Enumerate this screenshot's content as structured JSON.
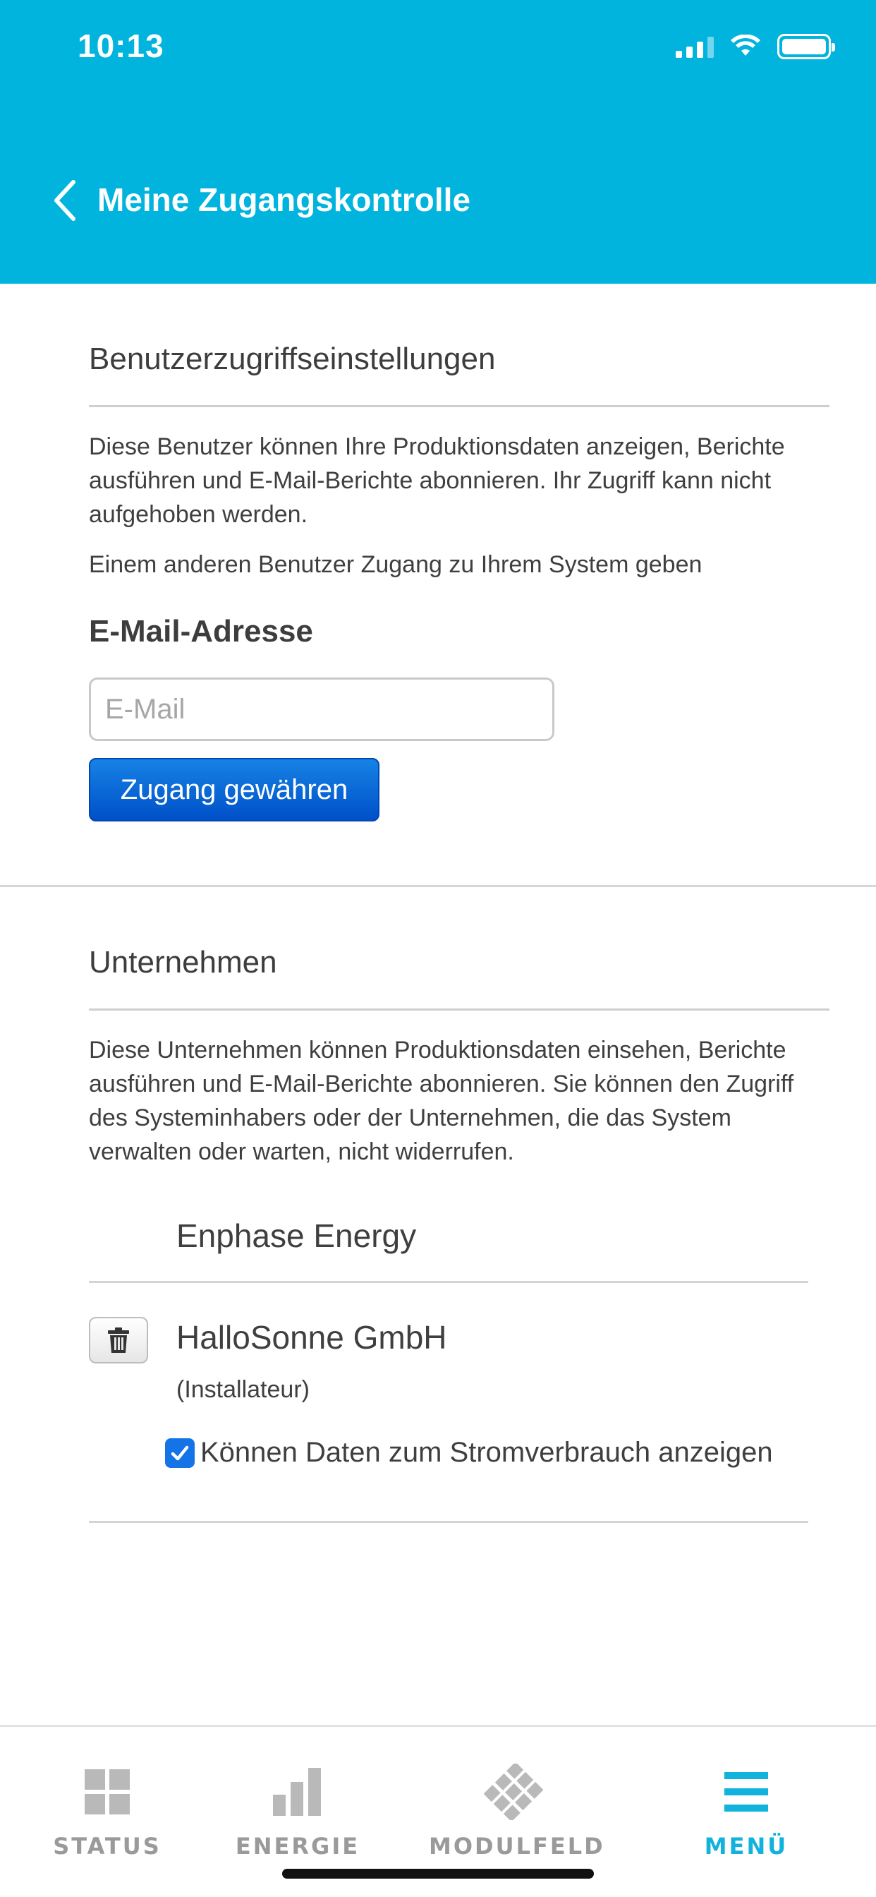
{
  "status_bar": {
    "time": "10:13"
  },
  "header": {
    "title": "Meine Zugangskontrolle"
  },
  "user_access": {
    "title": "Benutzerzugriffseinstellungen",
    "description": "Diese Benutzer können Ihre Produktionsdaten anzeigen, Berichte ausführen und E-Mail-Berichte abonnieren. Ihr Zugriff kann nicht aufgehoben werden.",
    "grant_text": "Einem anderen Benutzer Zugang zu Ihrem System geben",
    "email_label": "E-Mail-Adresse",
    "email_placeholder": "E-Mail",
    "email_value": "",
    "grant_button": "Zugang gewähren"
  },
  "companies": {
    "title": "Unternehmen",
    "description": "Diese Unternehmen können Produktionsdaten einsehen, Berichte ausführen und E-Mail-Berichte abonnieren. Sie können den Zugriff des Systeminhabers oder der Unternehmen, die das System verwalten oder warten, nicht widerrufen.",
    "items": [
      {
        "name": "Enphase Energy"
      },
      {
        "name": "HalloSonne GmbH",
        "role": "(Installateur)",
        "checkbox_label": "Können Daten zum Stromverbrauch anzeigen",
        "checked": true
      }
    ]
  },
  "tabbar": {
    "tabs": [
      {
        "label": "STATUS",
        "icon": "grid-icon"
      },
      {
        "label": "ENERGIE",
        "icon": "bar-chart-icon"
      },
      {
        "label": "MODULFELD",
        "icon": "panels-icon"
      },
      {
        "label": "MENÜ",
        "icon": "menu-icon",
        "active": true
      }
    ]
  },
  "colors": {
    "header": "#00b4dd",
    "button": "#0a63d8",
    "active_tab": "#11b2dc",
    "inactive_tab": "#9a9a9a"
  }
}
